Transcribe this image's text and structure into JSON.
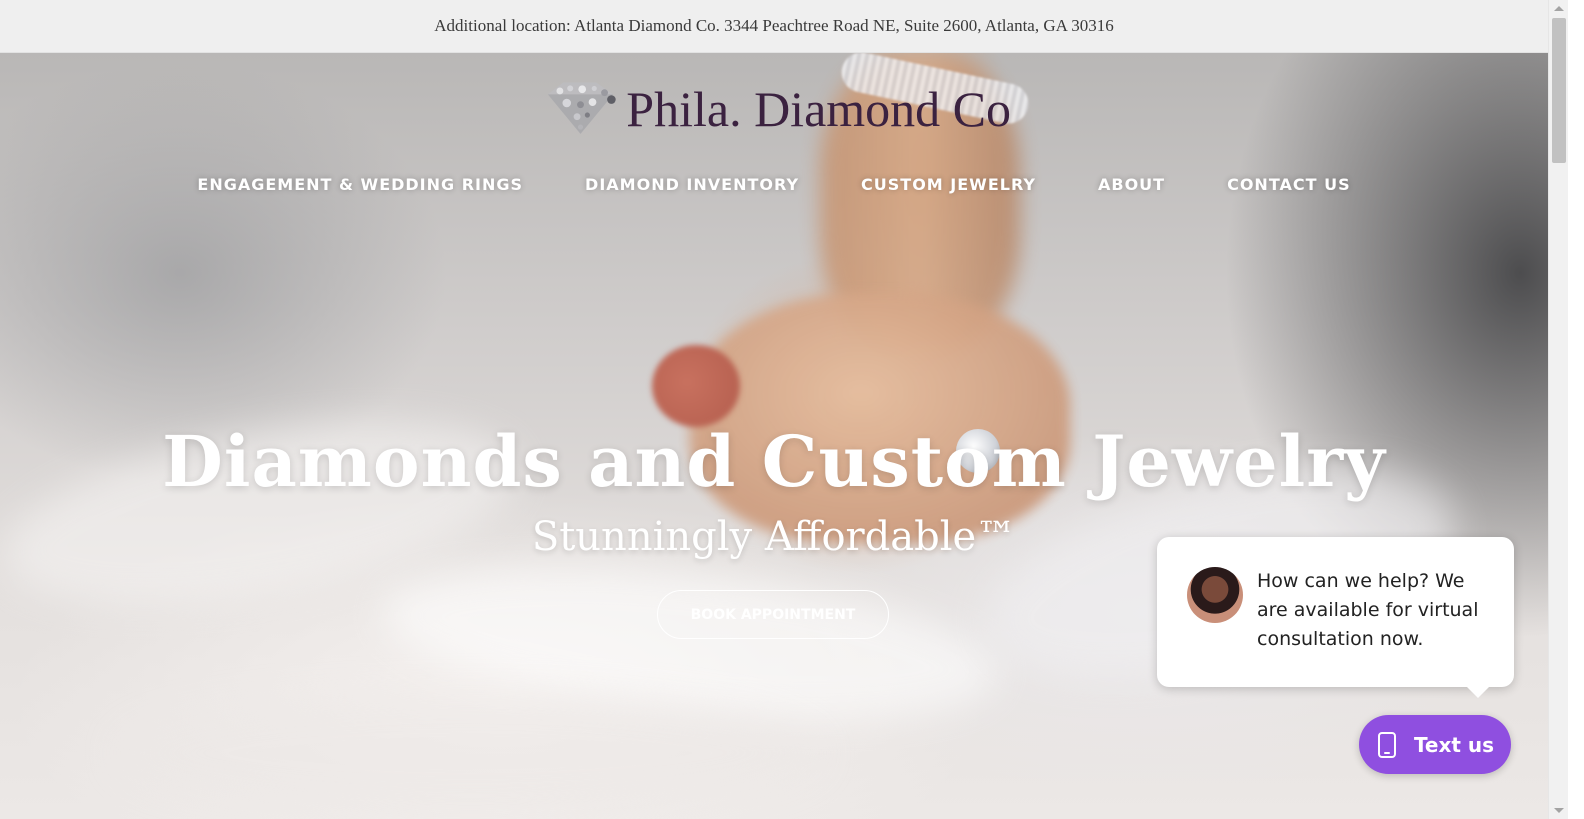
{
  "topbar": {
    "text": "Additional location: Atlanta Diamond Co. 3344 Peachtree Road NE, Suite 2600, Atlanta, GA 30316"
  },
  "logo": {
    "text": "Phila. Diamond Co",
    "icon": "diamond-icon"
  },
  "nav": {
    "items": [
      {
        "label": "ENGAGEMENT & WEDDING RINGS"
      },
      {
        "label": "DIAMOND INVENTORY"
      },
      {
        "label": "CUSTOM JEWELRY"
      },
      {
        "label": "ABOUT"
      },
      {
        "label": "CONTACT US"
      }
    ]
  },
  "hero": {
    "headline": "Diamonds and Custom Jewelry",
    "subline": "Stunningly Affordable™",
    "cta_label": "BOOK APPOINTMENT"
  },
  "chat": {
    "message": "How can we help? We are available for virtual consultation now.",
    "button_label": "Text us",
    "button_color": "#8f4fe0"
  }
}
